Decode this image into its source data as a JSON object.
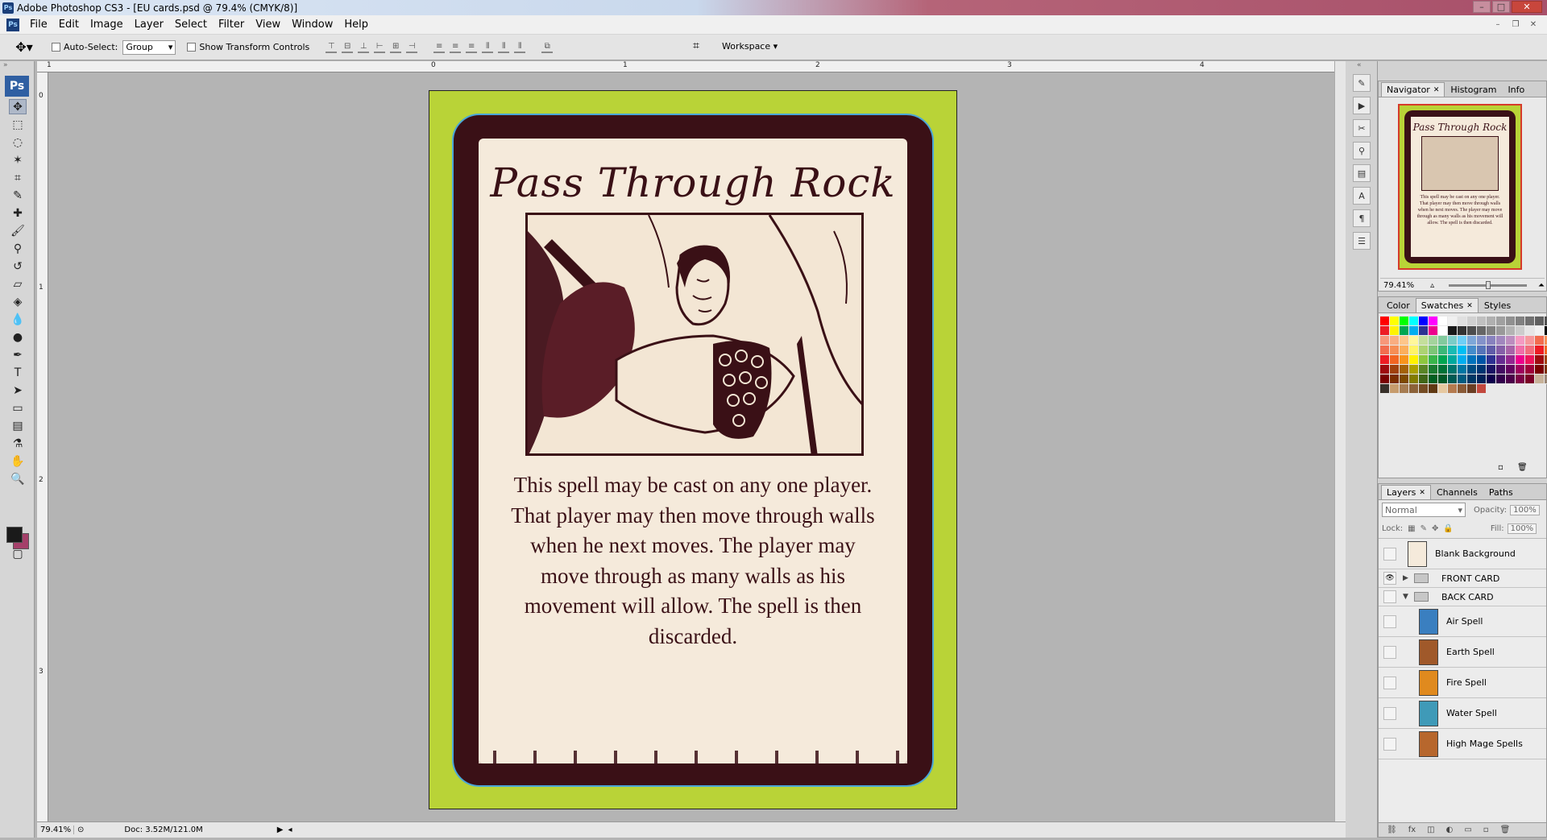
{
  "window": {
    "title": "Adobe Photoshop CS3 - [EU cards.psd @ 79.4% (CMYK/8)]",
    "app_icon": "Ps",
    "controls": [
      "–",
      "□",
      "✕"
    ]
  },
  "menu": {
    "items": [
      "File",
      "Edit",
      "Image",
      "Layer",
      "Select",
      "Filter",
      "View",
      "Window",
      "Help"
    ],
    "doc_controls": [
      "–",
      "❐",
      "✕"
    ]
  },
  "options": {
    "auto_select_label": "Auto-Select:",
    "auto_select_value": "Group",
    "show_transform_label": "Show Transform Controls",
    "workspace_label": "Workspace"
  },
  "toolbox": {
    "badge": "Ps",
    "tools": [
      "move",
      "marquee",
      "lasso",
      "magic-wand",
      "crop",
      "slice",
      "healing",
      "brush",
      "stamp",
      "history-brush",
      "eraser",
      "bucket",
      "blur",
      "dodge",
      "pen",
      "type",
      "path-select",
      "shape",
      "notes",
      "eyedropper",
      "hand",
      "zoom"
    ],
    "foreground": "#1a1a1a",
    "background": "#a5406a"
  },
  "rulers": {
    "top": [
      "1",
      "0",
      "1",
      "2",
      "3",
      "4"
    ],
    "left": [
      "0",
      "1",
      "2",
      "3"
    ]
  },
  "status": {
    "zoom": "79.41%",
    "doc": "Doc: 3.52M/121.0M"
  },
  "card": {
    "title": "Pass Through Rock",
    "body": "This spell may be cast on any one player. That player may then move through walls when he next moves.  The player may move through as many walls as his movement will allow.  The spell is then discarded.",
    "colors": {
      "outer": "#b9d337",
      "frame": "#3a1016",
      "border": "#49a6d8",
      "parchment": "#f5eadb"
    }
  },
  "navigator": {
    "tabs": [
      "Navigator",
      "Histogram",
      "Info"
    ],
    "zoom": "79.41%"
  },
  "swatches_panel": {
    "tabs": [
      "Color",
      "Swatches",
      "Styles"
    ],
    "colors": [
      "#ff0000",
      "#ffff00",
      "#00ff00",
      "#00ffff",
      "#0000ff",
      "#ff00ff",
      "#ffffff",
      "#f0f0f0",
      "#e0e0e0",
      "#d0d0d0",
      "#c0c0c0",
      "#b0b0b0",
      "#a0a0a0",
      "#909090",
      "#808080",
      "#707070",
      "#606060",
      "#505050",
      "#404040",
      "#303030",
      "#ed1c24",
      "#fff200",
      "#00a651",
      "#00aeef",
      "#2e3192",
      "#ec008c",
      "#ffffff",
      "#1a1a1a",
      "#333333",
      "#4d4d4d",
      "#666666",
      "#808080",
      "#999999",
      "#b3b3b3",
      "#cccccc",
      "#e6e6e6",
      "#f2f2f2",
      "#000000",
      "#262626",
      "#404040",
      "#f7977a",
      "#f9ad81",
      "#fdc68a",
      "#fff79a",
      "#c4df9b",
      "#a3d39c",
      "#82ca9d",
      "#7bcdc8",
      "#6ecff6",
      "#7ea7d8",
      "#8493ca",
      "#8882be",
      "#a187be",
      "#bc8dbf",
      "#f49ac2",
      "#f6989d",
      "#f26c4f",
      "#f68e55",
      "#fbaf5c",
      "#fff467",
      "#f26c4f",
      "#f68e55",
      "#fbaf5c",
      "#fff467",
      "#acd372",
      "#7cc576",
      "#3bb878",
      "#1abbb4",
      "#00bff3",
      "#438ccb",
      "#5574b9",
      "#605ca8",
      "#855fa8",
      "#a763a8",
      "#f06ea9",
      "#f26d7d",
      "#ed1c24",
      "#f26522",
      "#f7941d",
      "#fff200",
      "#ed1c24",
      "#f26522",
      "#f7941d",
      "#fff200",
      "#8dc73f",
      "#39b54a",
      "#00a651",
      "#00a99d",
      "#00aeef",
      "#0072bc",
      "#0054a6",
      "#2e3192",
      "#662d91",
      "#92278f",
      "#ec008c",
      "#ed145b",
      "#9e0b0f",
      "#a0410d",
      "#a36209",
      "#aba000",
      "#9e0b0f",
      "#a0410d",
      "#a36209",
      "#aba000",
      "#598527",
      "#1a7b30",
      "#007236",
      "#00746b",
      "#0076a3",
      "#004b80",
      "#003471",
      "#1b1464",
      "#440e62",
      "#630460",
      "#9e005d",
      "#9e0039",
      "#790000",
      "#7b2e00",
      "#7d4900",
      "#827b00",
      "#790000",
      "#7b2e00",
      "#7d4900",
      "#827b00",
      "#406618",
      "#005e20",
      "#005826",
      "#005952",
      "#005b7f",
      "#003663",
      "#002157",
      "#0d004c",
      "#32004b",
      "#4b0049",
      "#7b0046",
      "#7a0026",
      "#c7b299",
      "#998675",
      "#736357",
      "#534741",
      "#37302a",
      "#c69c6d",
      "#a67c52",
      "#8c6239",
      "#754c24",
      "#603913",
      "#e6c8a0",
      "#b57b4f",
      "#8a5a36",
      "#6b3e23",
      "#c2483d"
    ]
  },
  "layers": {
    "tabs": [
      "Layers",
      "Channels",
      "Paths"
    ],
    "blend_mode": "Normal",
    "opacity_label": "Opacity:",
    "opacity": "100%",
    "lock_label": "Lock:",
    "fill_label": "Fill:",
    "fill": "100%",
    "items": [
      {
        "name": "Blank Background",
        "type": "layer",
        "thumb": "#f5eadb",
        "visible": false
      },
      {
        "name": "FRONT CARD",
        "type": "group",
        "expanded": false,
        "visible": true
      },
      {
        "name": "BACK CARD",
        "type": "group",
        "expanded": true,
        "visible": false
      },
      {
        "name": "Air Spell",
        "type": "layer",
        "thumb": "#3a7fc0",
        "visible": false
      },
      {
        "name": "Earth Spell",
        "type": "layer",
        "thumb": "#a0592a",
        "visible": false
      },
      {
        "name": "Fire Spell",
        "type": "layer",
        "thumb": "#e08a1e",
        "visible": false
      },
      {
        "name": "Water Spell",
        "type": "layer",
        "thumb": "#3f9ab8",
        "visible": false
      },
      {
        "name": "High Mage Spells",
        "type": "layer",
        "thumb": "#b7672d",
        "visible": false
      }
    ]
  }
}
